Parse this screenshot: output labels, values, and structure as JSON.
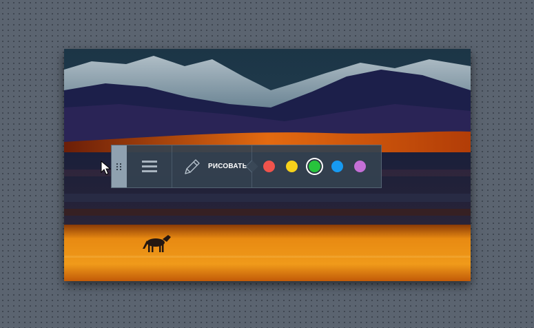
{
  "photo": {
    "subject": "horse-in-steppe-photo"
  },
  "toolbar": {
    "drag_handle_icon": "grip-dots-icon",
    "menu_icon": "hamburger-menu-icon",
    "draw_icon": "pencil-icon",
    "draw_label": "РИСОВАТЬ",
    "colors": [
      {
        "name": "red",
        "hex": "#f0534c",
        "selected": false
      },
      {
        "name": "yellow",
        "hex": "#f6d11b",
        "selected": false
      },
      {
        "name": "green",
        "hex": "#27c43c",
        "selected": true
      },
      {
        "name": "blue",
        "hex": "#179af1",
        "selected": false
      },
      {
        "name": "purple",
        "hex": "#c46fd6",
        "selected": false
      }
    ]
  },
  "cursor": {
    "icon": "arrow-cursor-icon"
  }
}
